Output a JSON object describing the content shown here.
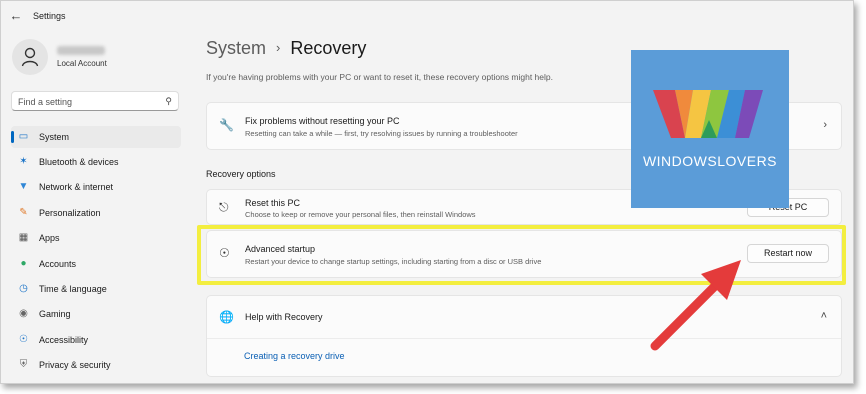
{
  "window": {
    "title": "Settings",
    "back_icon": "back-arrow-icon"
  },
  "account": {
    "type": "Local Account"
  },
  "search": {
    "placeholder": "Find a setting",
    "icon": "search-icon"
  },
  "sidebar": {
    "items": [
      {
        "label": "System",
        "icon": "system-icon",
        "color": "#1a73c7",
        "active": true
      },
      {
        "label": "Bluetooth & devices",
        "icon": "bluetooth-icon",
        "color": "#1a73c7"
      },
      {
        "label": "Network & internet",
        "icon": "network-icon",
        "color": "#2f86d6"
      },
      {
        "label": "Personalization",
        "icon": "brush-icon",
        "color": "#e07b2c"
      },
      {
        "label": "Apps",
        "icon": "apps-icon",
        "color": "#555555"
      },
      {
        "label": "Accounts",
        "icon": "accounts-icon",
        "color": "#2ea866"
      },
      {
        "label": "Time & language",
        "icon": "globe-clock-icon",
        "color": "#1a73c7"
      },
      {
        "label": "Gaming",
        "icon": "gaming-icon",
        "color": "#666666"
      },
      {
        "label": "Accessibility",
        "icon": "accessibility-icon",
        "color": "#1a73c7"
      },
      {
        "label": "Privacy & security",
        "icon": "shield-icon",
        "color": "#666666"
      }
    ]
  },
  "header": {
    "parent": "System",
    "separator": "›",
    "title": "Recovery"
  },
  "subtitle": "If you're having problems with your PC or want to reset it, these recovery options might help.",
  "fix_card": {
    "title": "Fix problems without resetting your PC",
    "desc": "Resetting can take a while — first, try resolving issues by running a troubleshooter",
    "icon": "wrench-icon"
  },
  "section_title": "Recovery options",
  "reset_card": {
    "title": "Reset this PC",
    "desc": "Choose to keep or remove your personal files, then reinstall Windows",
    "button": "Reset PC",
    "icon": "reset-pc-icon"
  },
  "advanced_card": {
    "title": "Advanced startup",
    "desc": "Restart your device to change startup settings, including starting from a disc or USB drive",
    "button": "Restart now",
    "icon": "advanced-startup-icon"
  },
  "help_card": {
    "title": "Help with Recovery",
    "link": "Creating a recovery drive",
    "icon": "globe-icon"
  },
  "watermark": {
    "text": "WINDOWSLOVERS"
  },
  "colors": {
    "accent": "#0067c0",
    "highlight": "#f3ee3f",
    "arrow": "#e43b3b"
  }
}
